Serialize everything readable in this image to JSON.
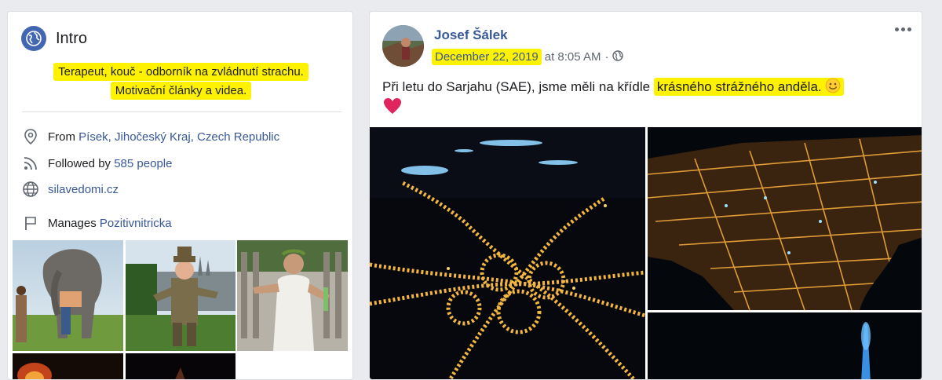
{
  "intro": {
    "title": "Intro",
    "bio_line1": "Terapeut, kouč - odborník na zvládnutí strachu.",
    "bio_line2": "Motivační články a videa.",
    "from_label": "From",
    "from_value": "Písek, Jihočeský Kraj, Czech Republic",
    "followed_label": "Followed by",
    "followed_value": "585 people",
    "website": "silavedomi.cz",
    "manages_label": "Manages",
    "manages_value": "Pozitivnitricka"
  },
  "post": {
    "author": "Josef Šálek",
    "date": "December 22, 2019",
    "time": "at 8:05 AM",
    "separator": "·",
    "text_before": "Při letu do Sarjahu (SAE), jsme měli na křídle",
    "text_highlight": "krásného strážného anděla."
  },
  "colors": {
    "link": "#385898",
    "highlight": "#fff200",
    "badge": "#4267b2",
    "background": "#e9ebee"
  },
  "icons": [
    "globe-icon",
    "location-pin-icon",
    "rss-icon",
    "website-globe-icon",
    "flag-icon",
    "more-dots-icon",
    "smile-emoji-icon",
    "heart-emoji-icon"
  ]
}
